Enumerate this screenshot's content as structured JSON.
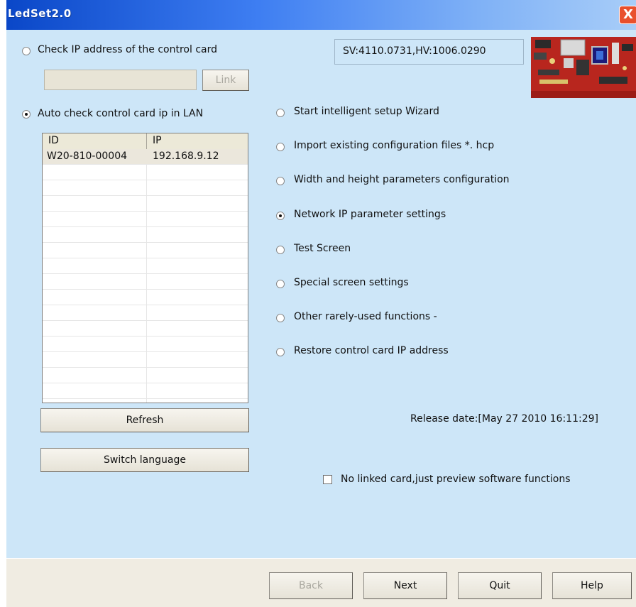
{
  "window": {
    "title": "LedSet2.0",
    "close_glyph": "X"
  },
  "left": {
    "check_ip_label": "Check IP address of the control card",
    "link_button": "Link",
    "auto_check_label": "Auto check control card ip in LAN",
    "columns": [
      "ID",
      "IP"
    ],
    "rows": [
      {
        "id": "W20-810-00004",
        "ip": "192.168.9.12"
      }
    ],
    "refresh_button": "Refresh",
    "switch_language_button": "Switch language"
  },
  "version": "SV:4110.0731,HV:1006.0290",
  "options": [
    {
      "label": "Start intelligent setup Wizard",
      "checked": false
    },
    {
      "label": "Import existing configuration files *. hcp",
      "checked": false
    },
    {
      "label": "Width and height parameters configuration",
      "checked": false
    },
    {
      "label": "Network IP parameter settings",
      "checked": true
    },
    {
      "label": "Test Screen",
      "checked": false
    },
    {
      "label": "Special screen settings",
      "checked": false
    },
    {
      "label": "Other rarely-used functions  -",
      "checked": false
    },
    {
      "label": "Restore control card IP address",
      "checked": false
    }
  ],
  "release_date": "Release date:[May 27 2010 16:11:29]",
  "preview_checkbox_label": "No linked card,just preview software functions",
  "footer": {
    "back": "Back",
    "next": "Next",
    "quit": "Quit",
    "help": "Help"
  },
  "icons": {
    "control_card_image": "control-card-photo"
  },
  "colors": {
    "title_start": "#0a47c8",
    "title_end": "#a8cdf8",
    "client_bg": "#cde6f8",
    "footer_bg": "#f0ece2"
  }
}
